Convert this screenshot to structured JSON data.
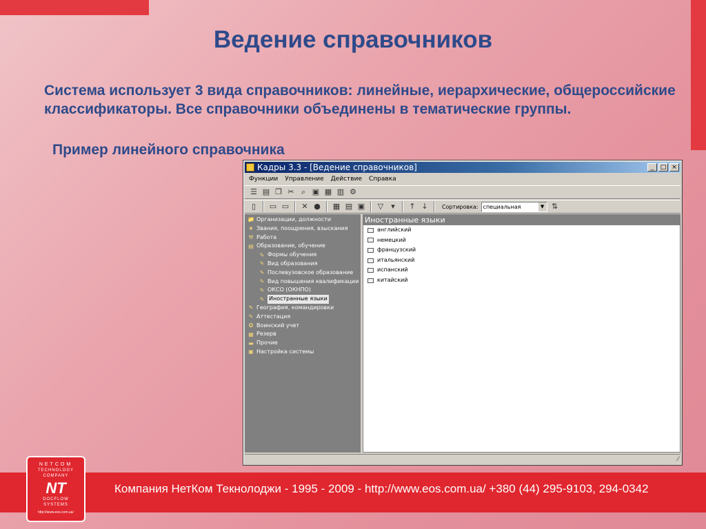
{
  "slide": {
    "title": "Ведение справочников",
    "text": "Система использует 3 вида справочников: линейные, иерархические, общероссийские классификаторы. Все справочники объединены в тематические группы.",
    "subtitle": "Пример линейного справочника"
  },
  "window": {
    "title": "Кадры 3.3 - [Ведение справочников]",
    "buttons": {
      "minimize": "_",
      "maximize": "□",
      "close": "×"
    },
    "menu": [
      "Функции",
      "Управление",
      "Действие",
      "Справка"
    ],
    "toolbar2": {
      "sort_label": "Сортировка:",
      "sort_value": "специальная"
    },
    "tree": [
      {
        "label": "Организации, должности",
        "level": 0,
        "icon": "📁"
      },
      {
        "label": "Звания, поощрения, взыскания",
        "level": 0,
        "icon": "★"
      },
      {
        "label": "Работа",
        "level": 0,
        "icon": "⚒"
      },
      {
        "label": "Образование, обучение",
        "level": 0,
        "icon": "▤"
      },
      {
        "label": "Формы обучения",
        "level": 1,
        "icon": "✎"
      },
      {
        "label": "Вид образования",
        "level": 1,
        "icon": "✎"
      },
      {
        "label": "Послевузовское образование",
        "level": 1,
        "icon": "✎"
      },
      {
        "label": "Вид повышения квалификации",
        "level": 1,
        "icon": "✎"
      },
      {
        "label": "ОКСО (ОКНПО)",
        "level": 1,
        "icon": "✎"
      },
      {
        "label": "Иностранные языки",
        "level": 1,
        "icon": "✎",
        "selected": true
      },
      {
        "label": "География, командировки",
        "level": 0,
        "icon": "✎"
      },
      {
        "label": "Аттестация",
        "level": 0,
        "icon": "✎"
      },
      {
        "label": "Воинский учет",
        "level": 0,
        "icon": "✪"
      },
      {
        "label": "Резерв",
        "level": 0,
        "icon": "▦"
      },
      {
        "label": "Прочие",
        "level": 0,
        "icon": "▬"
      },
      {
        "label": "Настройка системы",
        "level": 0,
        "icon": "▣"
      }
    ],
    "list_header": "Иностранные языки",
    "list_items": [
      "английский",
      "немецкий",
      "французский",
      "итальянский",
      "испанский",
      "китайский"
    ]
  },
  "footer": {
    "text": "Компания НетКом Текнолоджи - 1995 - 2009 - http://www.eos.com.ua/ +380 (44) 295-9103, 294-0342",
    "logo": {
      "line1": "NETCOM",
      "line2": "TECHNOLOGY",
      "line3": "COMPANY",
      "mark": "NT",
      "line4": "DOCFLOW",
      "line5": "SYSTEMS",
      "url": "http://www.eos.com.ua/"
    }
  },
  "colors": {
    "title_text": "#2e4a8a",
    "accent_red": "#e0262e",
    "titlebar": "#0a246a"
  }
}
